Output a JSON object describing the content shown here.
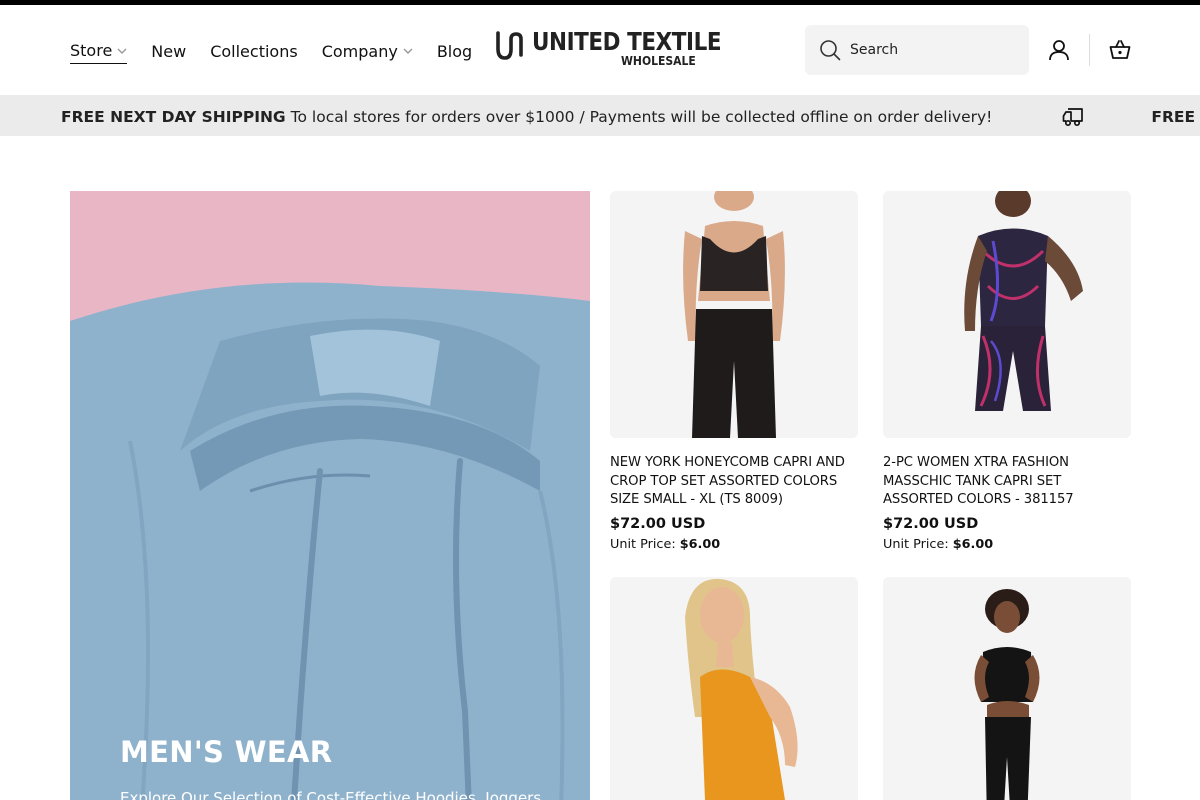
{
  "nav": {
    "items": [
      {
        "label": "Store",
        "dropdown": true,
        "active": true
      },
      {
        "label": "New",
        "dropdown": false
      },
      {
        "label": "Collections",
        "dropdown": false
      },
      {
        "label": "Company",
        "dropdown": true
      },
      {
        "label": "Blog",
        "dropdown": false
      }
    ]
  },
  "logo": {
    "main": "UNITED TEXTILE",
    "sub": "WHOLESALE"
  },
  "search": {
    "placeholder": "Search",
    "icon": "search-icon"
  },
  "header_icons": {
    "account": "user-icon",
    "cart": "basket-icon"
  },
  "announcement": {
    "bold": "FREE NEXT DAY SHIPPING",
    "text": "To local stores for orders over $1000 / Payments will be collected offline on order delivery!",
    "icon": "delivery-truck-icon",
    "repeat_bold": "FREE NEXT DAY SHIPPING"
  },
  "hero": {
    "title": "MEN'S WEAR",
    "description": "Explore Our Selection of Cost-Effective Hoodies, Joggers"
  },
  "products": [
    {
      "title": "NEW YORK HONEYCOMB CAPRI AND CROP TOP SET ASSORTED COLORS SIZE SMALL - XL (TS 8009)",
      "price": "$72.00 USD",
      "unit_label": "Unit Price:",
      "unit_price": "$6.00"
    },
    {
      "title": "2-PC WOMEN XTRA FASHION MASSCHIC TANK CAPRI SET ASSORTED COLORS - 381157",
      "price": "$72.00 USD",
      "unit_label": "Unit Price:",
      "unit_price": "$6.00"
    },
    {
      "title": "",
      "price": "",
      "unit_label": "",
      "unit_price": ""
    },
    {
      "title": "",
      "price": "",
      "unit_label": "",
      "unit_price": ""
    }
  ],
  "colors": {
    "hero_bg": "#e9b6c6",
    "hoodie": "#8fb2cc",
    "announcement_bg": "#ebebeb",
    "search_bg": "#f3f3f4"
  }
}
